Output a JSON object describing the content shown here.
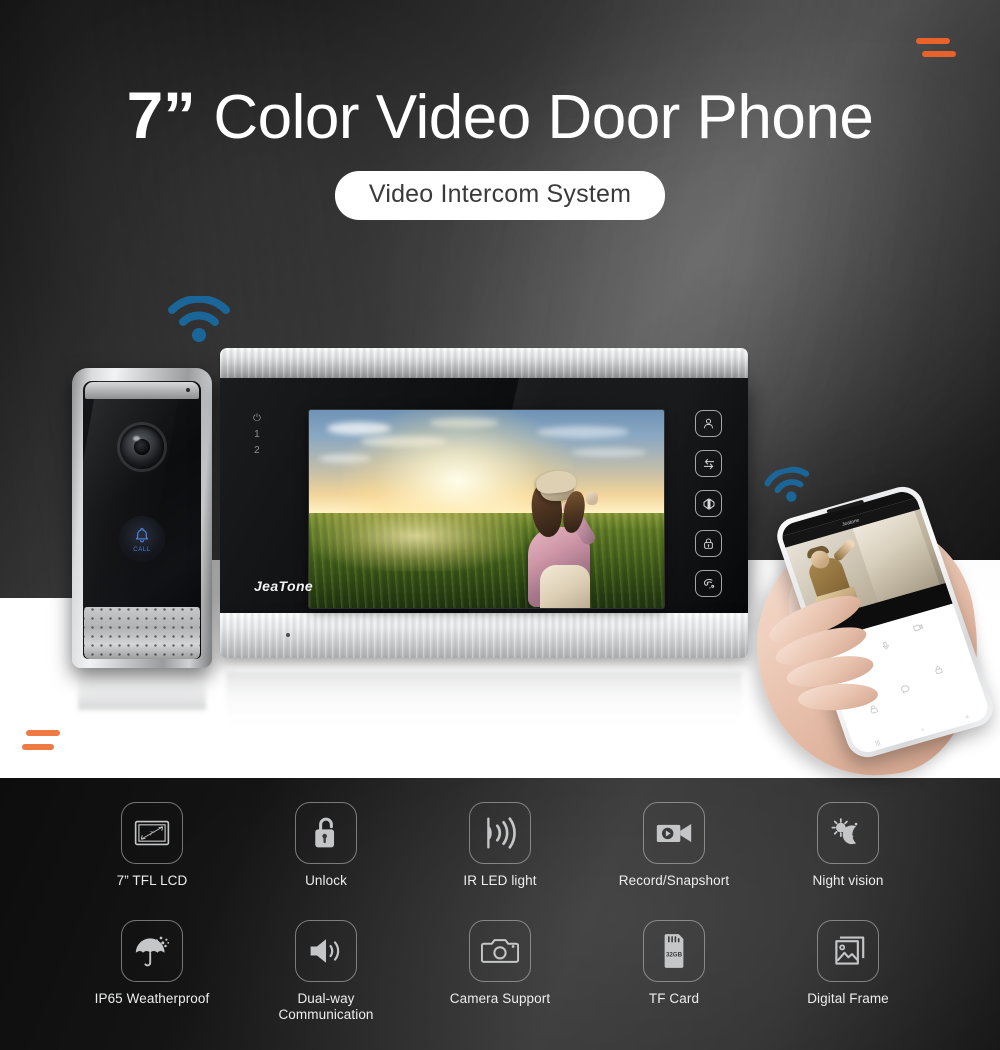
{
  "hero": {
    "title_inches": "7”",
    "title_main": "Color Video Door Phone",
    "subtitle": "Video Intercom System"
  },
  "colors": {
    "accent_orange": "#e8622a",
    "wifi_blue": "#1b6699",
    "call_blue": "#4f7fd6",
    "feature_icon": "#c4c6c8"
  },
  "door_station": {
    "call_label": "CALL",
    "icons": [
      "camera-lens-icon",
      "microphone-icon",
      "bell-icon",
      "speaker-grille-icon"
    ]
  },
  "monitor": {
    "brand": "JeaTone",
    "led_indicators": [
      "⏻",
      "1",
      "2"
    ],
    "buttons": [
      {
        "name": "contact-button",
        "icon": "person-icon"
      },
      {
        "name": "transfer-button",
        "icon": "transfer-arrows-icon"
      },
      {
        "name": "monitor-button",
        "icon": "monitor-split-icon"
      },
      {
        "name": "unlock-button",
        "icon": "padlock-icon"
      },
      {
        "name": "call-button",
        "icon": "phone-handset-icon"
      }
    ],
    "screen_content": "girl-in-wheat-field-at-sunset"
  },
  "phone": {
    "app_title": "Jeatone",
    "screen_content": "delivery-courier-at-door",
    "control_icons": [
      "snapshot-icon",
      "mic-icon",
      "record-icon",
      "unlock-icon",
      "talk-icon",
      "lock-icon"
    ],
    "nav_icons": [
      "|||",
      "○",
      "<"
    ]
  },
  "features": {
    "row1": [
      {
        "label": "7” TFL LCD",
        "icon": "lcd-screen-icon",
        "badge": "7”"
      },
      {
        "label": "Unlock",
        "icon": "open-padlock-icon"
      },
      {
        "label": "IR LED light",
        "icon": "ir-led-waves-icon"
      },
      {
        "label": "Record/Snapshort",
        "icon": "video-camera-icon"
      },
      {
        "label": "Night vision",
        "icon": "sun-moon-icon"
      }
    ],
    "row2": [
      {
        "label": "IP65 Weatherproof",
        "icon": "umbrella-rain-icon"
      },
      {
        "label": "Dual-way\nCommunication",
        "icon": "speaker-waves-icon"
      },
      {
        "label": "Camera Support",
        "icon": "photo-camera-icon"
      },
      {
        "label": "TF Card",
        "icon": "sd-card-icon",
        "badge": "32GB"
      },
      {
        "label": "Digital Frame",
        "icon": "picture-frames-icon"
      }
    ]
  }
}
